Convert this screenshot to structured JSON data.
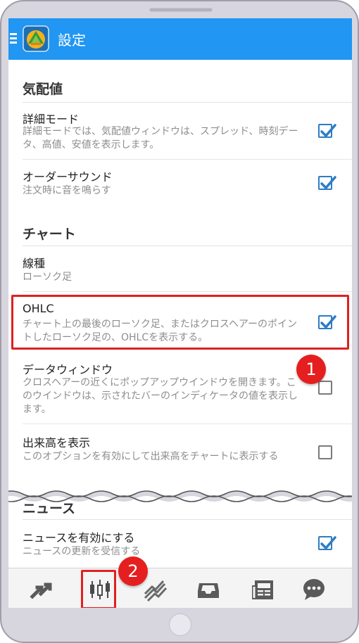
{
  "appbar": {
    "title": "設定",
    "color": "#2196f3"
  },
  "sections": {
    "quotes": {
      "header": "気配値",
      "rows": [
        {
          "title": "詳細モード",
          "summary": "詳細モードでは、気配値ウィンドウは、スプレッド、時刻データ、高値、安値を表示します。",
          "checked": true
        },
        {
          "title": "オーダーサウンド",
          "summary": "注文時に音を鳴らす",
          "checked": true
        }
      ]
    },
    "chart": {
      "header": "チャート",
      "rows": [
        {
          "title": "線種",
          "summary": "ローソク足"
        },
        {
          "title": "OHLC",
          "summary": "チャート上の最後のローソク足、またはクロスヘアーのポイントしたローソク足の、OHLCを表示する。",
          "checked": true
        },
        {
          "title": "データウィンドウ",
          "summary": "クロスヘアーの近くにポップアップウインドウを開きます。このウインドウは、示されたバーのインディケータの値を表示します。",
          "checked": false
        },
        {
          "title": "出来高を表示",
          "summary": "このオプションを有効にして出来高をチャートに表示する",
          "checked": false
        }
      ]
    },
    "news": {
      "header": "ニュース",
      "rows": [
        {
          "title": "ニュースを有効にする",
          "summary": "ニュースの更新を受信する",
          "checked": true
        }
      ]
    }
  },
  "annotations": {
    "badge1": "1",
    "badge2": "2",
    "highlight_color": "#e1201f"
  },
  "bottom_nav": {
    "items": [
      {
        "icon": "trade-arrows-icon"
      },
      {
        "icon": "candlestick-chart-icon",
        "active": true
      },
      {
        "icon": "trend-lines-icon"
      },
      {
        "icon": "inbox-tray-icon"
      },
      {
        "icon": "news-icon"
      },
      {
        "icon": "chat-icon"
      }
    ]
  }
}
